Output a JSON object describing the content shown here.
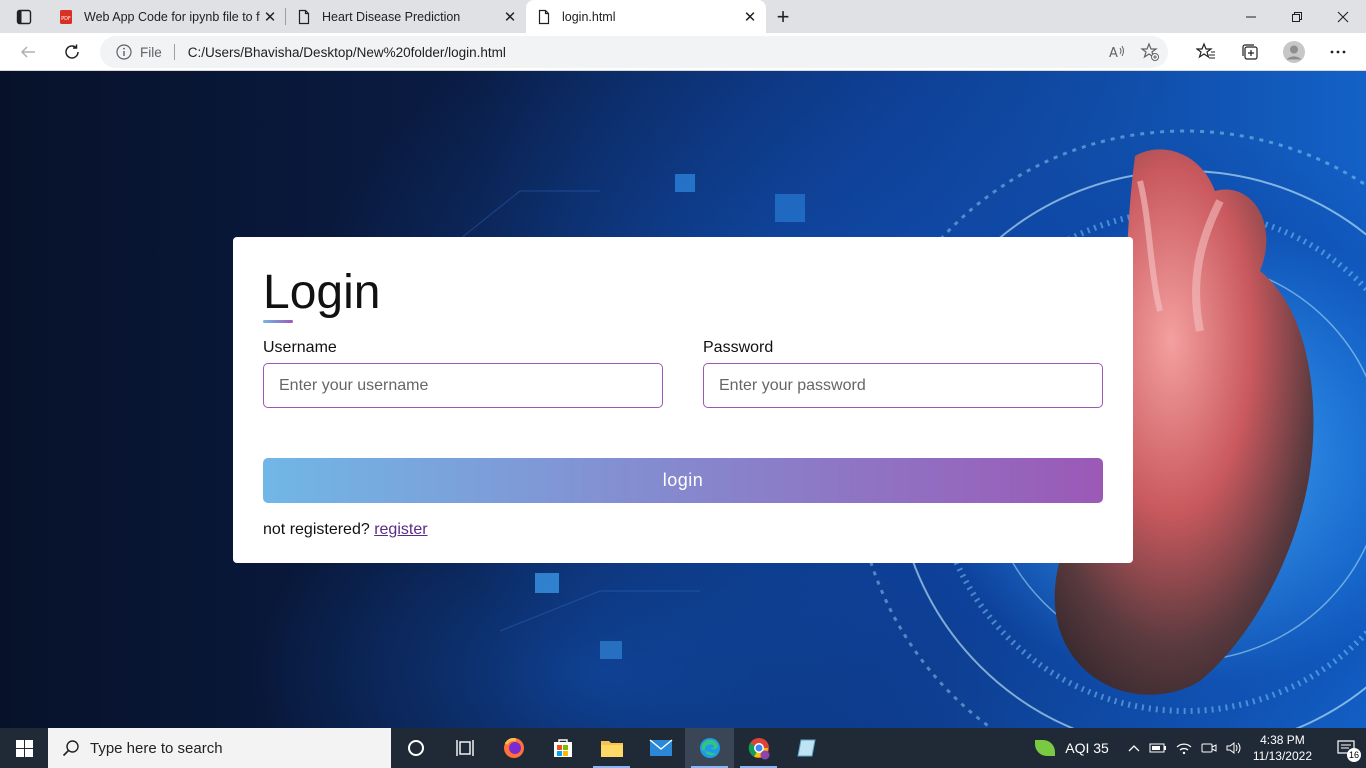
{
  "browser": {
    "tabs": [
      {
        "title": "Web App Code for ipynb file to f",
        "icon": "pdf-icon",
        "active": false
      },
      {
        "title": "Heart Disease Prediction",
        "icon": "page-icon",
        "active": false
      },
      {
        "title": "login.html",
        "icon": "page-icon",
        "active": true
      }
    ],
    "address": {
      "scheme_label": "File",
      "url": "C:/Users/Bhavisha/Desktop/New%20folder/login.html"
    }
  },
  "login": {
    "heading": "Login",
    "username_label": "Username",
    "username_placeholder": "Enter your username",
    "password_label": "Password",
    "password_placeholder": "Enter your password",
    "submit_label": "login",
    "register_prompt": "not registered?",
    "register_link": "register"
  },
  "taskbar": {
    "search_placeholder": "Type here to search",
    "aqi": "AQI 35",
    "time": "4:38 PM",
    "date": "11/13/2022",
    "notifications": "16"
  },
  "colors": {
    "accent_start": "#71b7e6",
    "accent_end": "#9b59b6",
    "input_border": "#9b59b6"
  }
}
